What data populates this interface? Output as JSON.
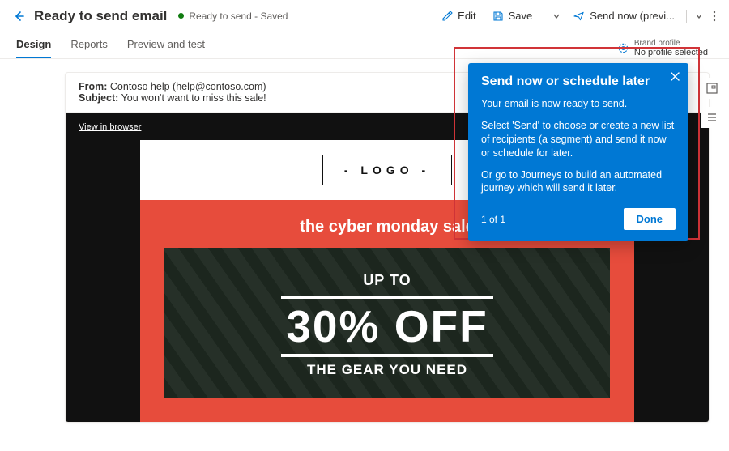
{
  "header": {
    "title": "Ready to send email",
    "status": "Ready to send - Saved",
    "actions": {
      "edit": "Edit",
      "save": "Save",
      "send_now": "Send now (previ..."
    }
  },
  "tabs": {
    "design": "Design",
    "reports": "Reports",
    "preview": "Preview and test"
  },
  "brand_profile": {
    "label": "Brand profile",
    "value": "No profile selected"
  },
  "email": {
    "from_label": "From:",
    "from_value": "Contoso help (help@contoso.com)",
    "subject_label": "Subject:",
    "subject_value": "You won't want to miss this sale!"
  },
  "preview": {
    "view_in_browser": "View in browser",
    "logo_text": "- LOGO -",
    "headline": "the cyber monday sale",
    "hero_upto": "UP TO",
    "hero_discount": "30% OFF",
    "hero_gear": "THE GEAR YOU NEED"
  },
  "callout": {
    "title": "Send now or schedule later",
    "line1": "Your email is now ready to send.",
    "line2": "Select 'Send' to choose or create a new list of recipients (a segment) and send it now or schedule for later.",
    "line3": "Or go to Journeys to build an automated journey which will send it later.",
    "count": "1 of 1",
    "done": "Done"
  }
}
